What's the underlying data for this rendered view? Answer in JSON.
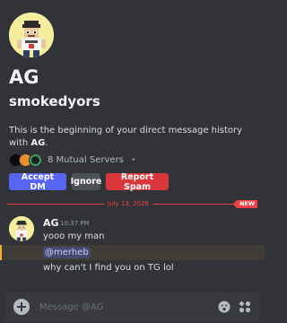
{
  "profile": {
    "display_name": "AG",
    "username": "smokedyors",
    "intro_text": "This is the beginning of your direct message history with",
    "intro_name": "AG",
    "intro_suffix": ".",
    "mutual_servers": "8 Mutual Servers",
    "separator": "•"
  },
  "actions": {
    "accept": "Accept DM",
    "ignore": "Ignore",
    "report": "Report Spam"
  },
  "divider": {
    "date": "July 13, 2026",
    "badge": "NEW"
  },
  "message": {
    "author": "AG",
    "time": "10:37 PM",
    "lines": [
      "yooo my man",
      "@merheb",
      "why can't I find you on TG lol"
    ]
  },
  "composer": {
    "placeholder": "Message @AG"
  },
  "icons": {
    "avatar": "pixel-character-avatar",
    "add": "plus-circle-icon",
    "emoji": "emoji-icon",
    "apps": "apps-icon"
  },
  "colors": {
    "background": "#313338",
    "accent": "#5865f2",
    "danger": "#da373c",
    "new_divider": "#f23f43",
    "mention_highlight": "#f0b232"
  }
}
